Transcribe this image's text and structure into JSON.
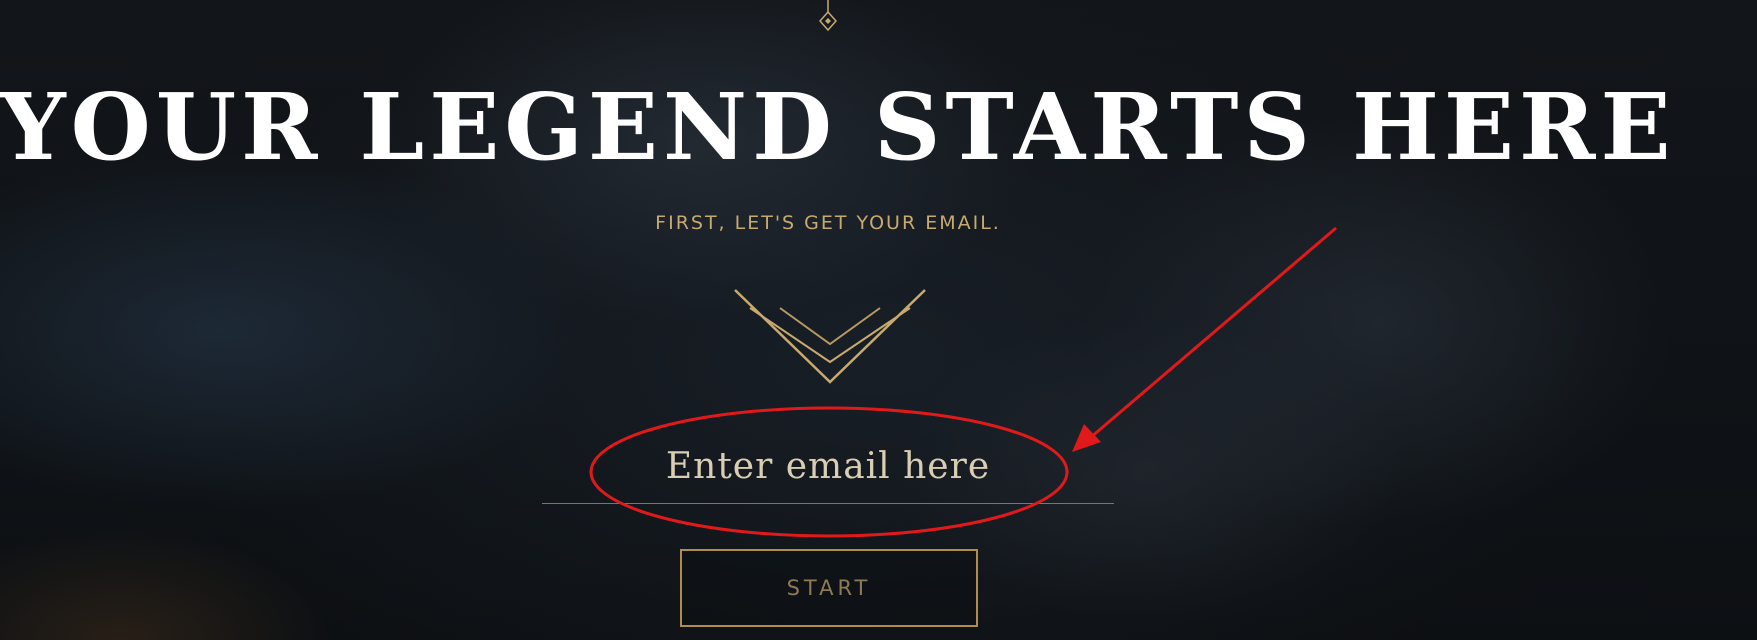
{
  "hero": {
    "headline": "YOUR LEGEND STARTS HERE",
    "subtitle": "FIRST, LET'S GET YOUR EMAIL."
  },
  "form": {
    "email_placeholder": "Enter email here",
    "email_value": "",
    "start_label": "START"
  },
  "colors": {
    "gold": "#c8aa6e",
    "button_border": "#b08d4e",
    "headline": "#ffffff",
    "annotation": "#e01a1a"
  },
  "icons": {
    "top_ornament": "diamond-ornament-icon",
    "divider": "gold-chevron-divider",
    "annotation_arrow": "red-arrow",
    "annotation_ellipse": "red-ellipse-highlight"
  }
}
